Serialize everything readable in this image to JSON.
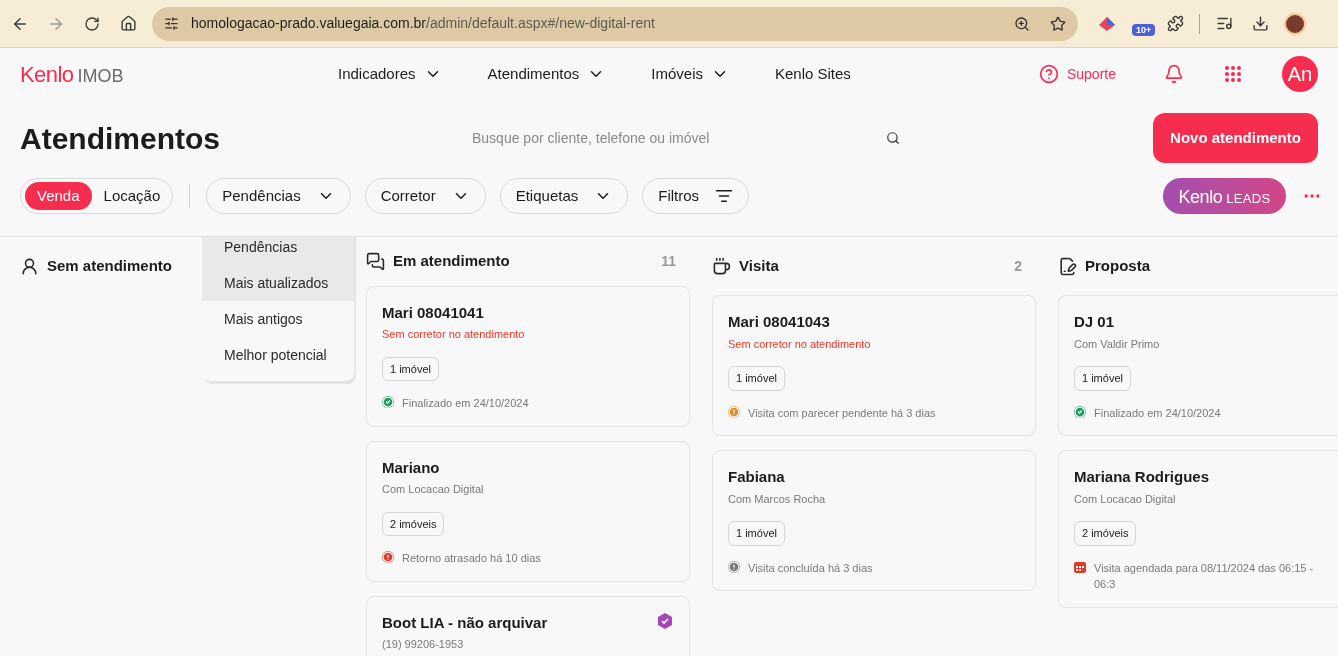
{
  "browser": {
    "url_host": "homologacao-prado.valuegaia.com.br",
    "url_path": "/admin/default.aspx#/new-digital-rent",
    "extension_badge": "10+"
  },
  "header": {
    "logo": {
      "brand": "Kenlo",
      "product": "IMOB"
    },
    "nav": [
      {
        "label": "Indicadores",
        "dropdown": true
      },
      {
        "label": "Atendimentos",
        "dropdown": true
      },
      {
        "label": "Imóveis",
        "dropdown": true
      },
      {
        "label": "Kenlo Sites",
        "dropdown": false
      }
    ],
    "support": "Suporte",
    "avatar": "An"
  },
  "page": {
    "title": "Atendimentos",
    "search": {
      "placeholder": "Busque por cliente, telefone ou imóvel"
    },
    "primary_button": "Novo atendimento"
  },
  "filters": {
    "segments": [
      {
        "label": "Venda",
        "selected": true
      },
      {
        "label": "Locação",
        "selected": false
      }
    ],
    "dropdowns": [
      {
        "label": "Pendências",
        "kind": "dropdown"
      },
      {
        "label": "Corretor",
        "kind": "dropdown"
      },
      {
        "label": "Etiquetas",
        "kind": "dropdown"
      },
      {
        "label": "Filtros",
        "kind": "filter"
      }
    ],
    "leads": {
      "brand": "Kenlo",
      "product": "LEADS"
    }
  },
  "sort_menu": [
    {
      "label": "Pendências",
      "highlighted": true
    },
    {
      "label": "Mais atualizados",
      "highlighted": true
    },
    {
      "label": "Mais antigos",
      "highlighted": false
    },
    {
      "label": "Melhor potencial",
      "highlighted": false
    }
  ],
  "columns": [
    {
      "title": "Sem atendimento",
      "kind": "waiting"
    },
    {
      "title": "Em atendimento",
      "kind": "service",
      "count": "11",
      "cards": [
        {
          "name": "Mari 08041041",
          "subtitle": "Sem corretor no atendimento",
          "alert": true,
          "chip": "1 imóvel",
          "status": {
            "kind": "check",
            "color": "#1f9d5c",
            "text": "Finalizado em 24/10/2024"
          }
        },
        {
          "name": "Mariano",
          "subtitle": "Com Locacao Digital",
          "alert": false,
          "chip": "2 imóveis",
          "status": {
            "kind": "info",
            "color": "#e03a2b",
            "text": "Retorno atrasado há 10 dias"
          }
        },
        {
          "name": "Boot LIA - não arquivar",
          "subtitle": "(19) 99206-1953",
          "alert": false,
          "verified": true
        }
      ]
    },
    {
      "title": "Visita",
      "kind": "visit",
      "count": "2",
      "cards": [
        {
          "name": "Mari 08041043",
          "subtitle": "Sem corretor no atendimento",
          "alert": true,
          "chip": "1 imóvel",
          "status": {
            "kind": "info",
            "color": "#e0902a",
            "text": "Visita com parecer pendente há 3 dias"
          }
        },
        {
          "name": "Fabiana",
          "subtitle": "Com Marcos Rocha",
          "alert": false,
          "chip": "1 imóvel",
          "status": {
            "kind": "info",
            "color": "#7a7a7a",
            "text": "Visita concluída há 3 dias"
          }
        }
      ]
    },
    {
      "title": "Proposta",
      "kind": "proposal",
      "cards": [
        {
          "name": "DJ 01",
          "subtitle": "Com Valdir Primo",
          "alert": false,
          "chip": "1 imóvel",
          "status": {
            "kind": "check",
            "color": "#1f9d5c",
            "text": "Finalizado em 24/10/2024"
          }
        },
        {
          "name": "Mariana Rodrigues",
          "subtitle": "Com Locacao Digital",
          "alert": false,
          "chip": "2 imóveis",
          "status": {
            "kind": "calendar",
            "color": "#e03a2b",
            "text": "Visita agendada para 08/11/2024 das 06:15 - 06:3"
          }
        }
      ]
    }
  ]
}
